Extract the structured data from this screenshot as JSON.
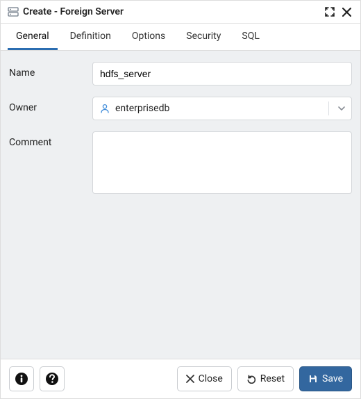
{
  "window": {
    "title": "Create - Foreign Server"
  },
  "tabs": [
    {
      "label": "General",
      "active": true
    },
    {
      "label": "Definition",
      "active": false
    },
    {
      "label": "Options",
      "active": false
    },
    {
      "label": "Security",
      "active": false
    },
    {
      "label": "SQL",
      "active": false
    }
  ],
  "form": {
    "name": {
      "label": "Name",
      "value": "hdfs_server"
    },
    "owner": {
      "label": "Owner",
      "value": "enterprisedb"
    },
    "comment": {
      "label": "Comment",
      "value": ""
    }
  },
  "footer": {
    "close_label": "Close",
    "reset_label": "Reset",
    "save_label": "Save"
  }
}
